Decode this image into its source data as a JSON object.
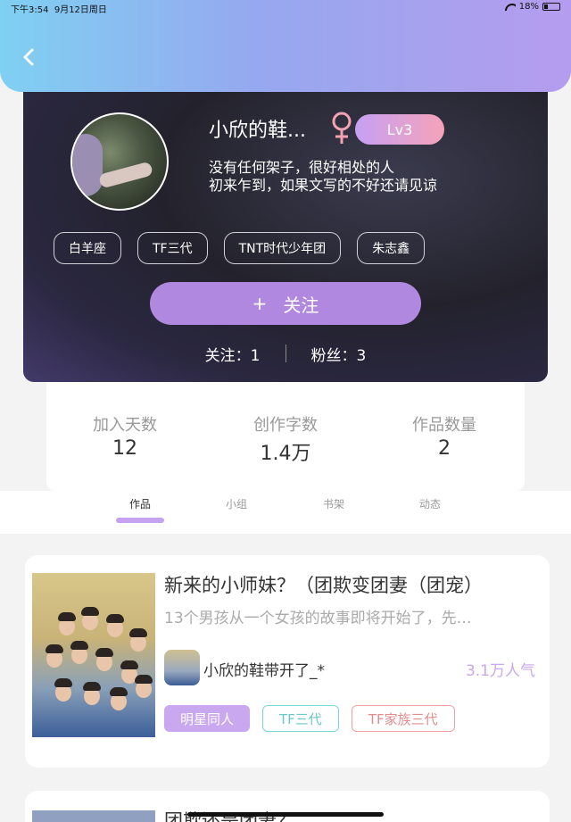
{
  "status_bar": {
    "time": "下午3:54",
    "date": "9月12日周日",
    "battery": "18%"
  },
  "profile": {
    "username": "小欣的鞋...",
    "gender_symbol": "♀",
    "level": "Lv3",
    "bio_line1": "没有任何架子，很好相处的人",
    "bio_line2": "初来乍到，如果文写的不好还请见谅",
    "tags": [
      "白羊座",
      "TF三代",
      "TNT时代少年团",
      "朱志鑫"
    ],
    "follow_button": {
      "plus": "+",
      "label": "关注"
    },
    "following": "关注：1",
    "fans": "粉丝：3"
  },
  "stats": [
    {
      "label": "加入天数",
      "value": "12"
    },
    {
      "label": "创作字数",
      "value": "1.4万"
    },
    {
      "label": "作品数量",
      "value": "2"
    }
  ],
  "tabs": [
    "作品",
    "小组",
    "书架",
    "动态"
  ],
  "works": [
    {
      "title": "新来的小师妹？（团欺变团妻（团宠）",
      "description": "13个男孩从一个女孩的故事即将开始了，先…",
      "author": "小欣的鞋带开了_*",
      "popularity": "3.1万人气",
      "tags": [
        "明星同人",
        "TF三代",
        "TF家族三代"
      ]
    },
    {
      "title": "团欺还是团妻？"
    }
  ],
  "colors": {
    "accent": "#c9a8ef",
    "follow_button": "#b088e0"
  }
}
